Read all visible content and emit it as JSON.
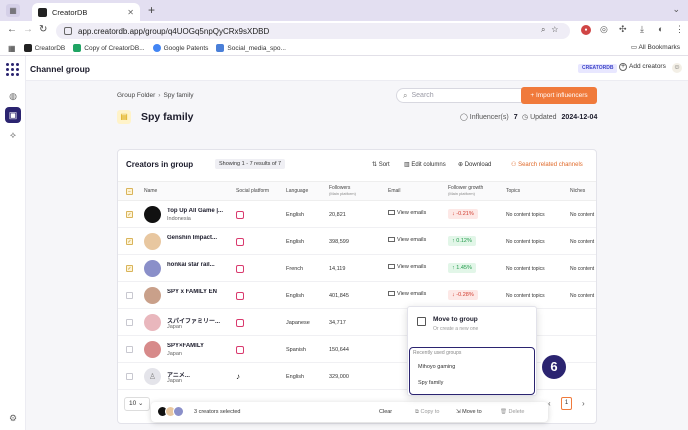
{
  "browser": {
    "tab_title": "CreatorDB",
    "url": "app.creatordb.app/group/q4UOGq5npQyCRx9sXDBD",
    "bookmarks": [
      "CreatorDB",
      "Copy of CreatorDB...",
      "Google Patents",
      "Social_media_spo..."
    ],
    "all_bookmarks": "All Bookmarks"
  },
  "app": {
    "title": "Channel group",
    "brand_chip": "CREATORDB",
    "add_creators": "Add creators"
  },
  "page": {
    "breadcrumb_parent": "Group Folder",
    "breadcrumb_current": "Spy family",
    "title": "Spy family",
    "search_placeholder": "Search",
    "import_button": "+ Import influencers",
    "influencers_label": "Influencer(s)",
    "influencers_count": "7",
    "updated_label": "Updated",
    "updated_date": "2024-12-04"
  },
  "table": {
    "title": "Creators in group",
    "showing": "Showing 1 - 7 results of 7",
    "sort": "Sort",
    "edit_columns": "Edit columns",
    "download": "Download",
    "search_related": "Search related channels",
    "headers": {
      "name": "Name",
      "platform": "Social platform",
      "language": "Language",
      "followers": "Followers",
      "followers_sub": "(Main platform)",
      "email": "Email",
      "growth": "Follower growth",
      "growth_sub": "(Main platform)",
      "topics": "Topics",
      "niches": "Niches"
    },
    "view_emails": "View emails",
    "no_topics": "No content topics",
    "no_niches": "No content",
    "rows": [
      {
        "name": "Top Up All Game |...",
        "sub": "Indonesia",
        "language": "English",
        "followers": "20,821",
        "growth": "-0.21%"
      },
      {
        "name": "Genshin Impact...",
        "sub": "",
        "language": "English",
        "followers": "398,599",
        "growth": "0.12%"
      },
      {
        "name": "honkai star rail...",
        "sub": "",
        "language": "French",
        "followers": "14,119",
        "growth": "1.45%"
      },
      {
        "name": "SPY x FAMILY EN",
        "sub": "",
        "language": "English",
        "followers": "401,845",
        "growth": "-0.28%"
      },
      {
        "name": "スパイファミリー...",
        "sub": "Japan",
        "language": "Japanese",
        "followers": "34,717",
        "growth": ""
      },
      {
        "name": "SPY×FAMILY",
        "sub": "Japan",
        "language": "Spanish",
        "followers": "150,644",
        "growth": ""
      },
      {
        "name": "アニメ...",
        "sub": "Japan",
        "language": "English",
        "followers": "329,000",
        "growth": ""
      }
    ],
    "page_size": "10",
    "current_page": "1"
  },
  "action_bar": {
    "selected": "3 creators selected",
    "clear": "Clear",
    "copy_to": "Copy to",
    "move_to": "Move to",
    "delete": "Delete"
  },
  "popup": {
    "title": "Move to group",
    "subtitle": "Or create a new one",
    "recent_label": "Recently used groups",
    "groups": [
      "Mihoyo gaming",
      "Spy family"
    ]
  },
  "step_badge": "6",
  "colors": {
    "accent": "#f07a3b",
    "brand": "#2b2470",
    "growth_down": "#d13c2f",
    "growth_up": "#219a4a"
  }
}
